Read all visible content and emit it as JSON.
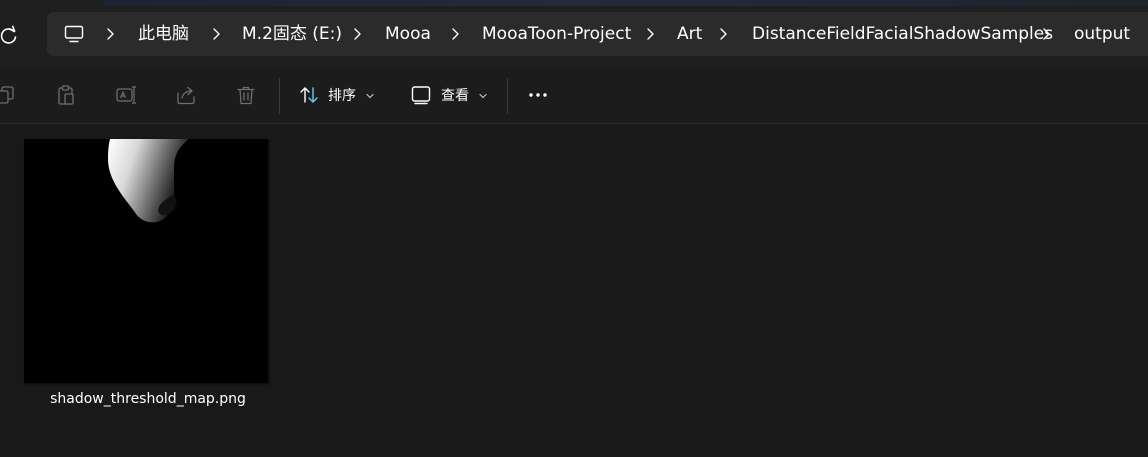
{
  "breadcrumb": {
    "root_icon": "pc-icon",
    "items": [
      "此电脑",
      "M.2固态 (E:)",
      "Mooa",
      "MooaToon-Project",
      "Art",
      "DistanceFieldFacialShadowSamples",
      "output"
    ]
  },
  "toolbar": {
    "icons": [
      "copy-icon",
      "paste-icon",
      "rename-icon",
      "share-icon",
      "delete-icon"
    ],
    "sort_label": "排序",
    "view_label": "查看",
    "more_icon": "more-icon"
  },
  "files": [
    {
      "name": "shadow_threshold_map.png",
      "thumbnail": "shadow-threshold-thumbnail"
    }
  ],
  "colors": {
    "background": "#191919",
    "address_bar": "#2b2b2b",
    "sort_accent": "#60cdff"
  }
}
